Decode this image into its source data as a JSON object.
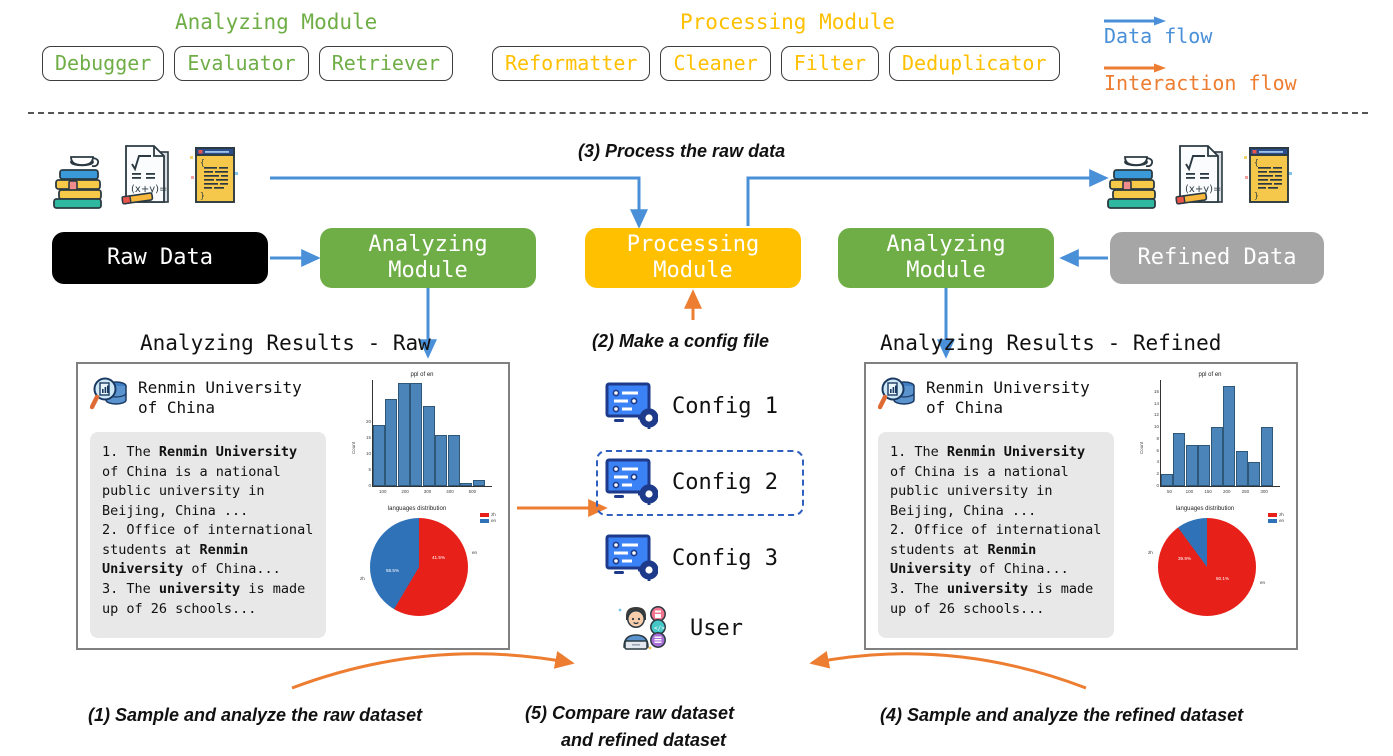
{
  "header": {
    "groups": [
      {
        "title": "Analyzing Module",
        "color": "#6fae46",
        "tags": [
          "Debugger",
          "Evaluator",
          "Retriever"
        ]
      },
      {
        "title": "Processing Module",
        "color": "#ffc000",
        "tags": [
          "Reformatter",
          "Cleaner",
          "Filter",
          "Deduplicator"
        ]
      }
    ],
    "legend": [
      {
        "label": "Data flow",
        "color": "#4a90d9",
        "icon": "arrow-right-icon"
      },
      {
        "label": "Interaction flow",
        "color": "#ed7d31",
        "icon": "arrow-right-icon"
      }
    ]
  },
  "flow": {
    "nodes": [
      {
        "name": "raw-data",
        "lines": [
          "Raw Data"
        ],
        "color": "#000000"
      },
      {
        "name": "analyzing-module-raw",
        "lines": [
          "Analyzing",
          "Module"
        ],
        "color": "#6fae46"
      },
      {
        "name": "processing-module",
        "lines": [
          "Processing",
          "Module"
        ],
        "color": "#ffc000"
      },
      {
        "name": "analyzing-module-refined",
        "lines": [
          "Analyzing",
          "Module"
        ],
        "color": "#6fae46"
      },
      {
        "name": "refined-data",
        "lines": [
          "Refined Data"
        ],
        "color": "#a6a6a6"
      }
    ],
    "step_labels": {
      "step3": "(3) Process the raw data",
      "step2": "(2) Make a config file"
    }
  },
  "captions": {
    "step1": "(1) Sample and analyze the raw dataset",
    "step5_line1": "(5) Compare raw dataset",
    "step5_line2": "and refined dataset",
    "step4": "(4) Sample and analyze the refined dataset"
  },
  "cards": [
    {
      "name": "analyzing-results-raw",
      "title": "Analyzing Results - Raw",
      "entity": "Renmin University\nof China",
      "snippet": [
        {
          "text": "1. The "
        },
        {
          "text": "Renmin University",
          "bold": true
        },
        {
          "text": "\nof China is a national\npublic university in\nBeijing, China ...\n2. Office of international\nstudents at "
        },
        {
          "text": "Renmin\nUniversity",
          "bold": true
        },
        {
          "text": " of China...\n3. The "
        },
        {
          "text": "university",
          "bold": true
        },
        {
          "text": " is made\nup of 26 schools..."
        }
      ]
    },
    {
      "name": "analyzing-results-refined",
      "title": "Analyzing Results - Refined",
      "entity": "Renmin University\nof China",
      "snippet": [
        {
          "text": "1. The "
        },
        {
          "text": "Renmin University",
          "bold": true
        },
        {
          "text": "\nof China is a national\npublic university in\nBeijing, China ...\n2. Office of international\nstudents at "
        },
        {
          "text": "Renmin\nUniversity",
          "bold": true
        },
        {
          "text": " of China...\n3. The "
        },
        {
          "text": "university",
          "bold": true
        },
        {
          "text": " is made\nup of 26 schools..."
        }
      ]
    }
  ],
  "configs": {
    "items": [
      {
        "label": "Config 1",
        "highlighted": false,
        "icon": "config-gear-icon"
      },
      {
        "label": "Config 2",
        "highlighted": true,
        "icon": "config-gear-icon"
      },
      {
        "label": "Config 3",
        "highlighted": false,
        "icon": "config-gear-icon"
      }
    ],
    "user": {
      "label": "User",
      "icon": "user-avatar-icon"
    }
  },
  "chart_data": [
    {
      "id": "raw-histogram",
      "type": "bar",
      "title": "ppl of en",
      "xlabel": "",
      "ylabel": "Count",
      "categories": [
        "100",
        "150",
        "200",
        "250",
        "300",
        "350",
        "400",
        "450",
        "500"
      ],
      "values": [
        19,
        27,
        32,
        32,
        25,
        16,
        16,
        1,
        2
      ],
      "ylim": [
        0,
        33
      ],
      "yticks": [
        0,
        5,
        10,
        15,
        20
      ],
      "xticks": [
        "100",
        "200",
        "300",
        "400",
        "500"
      ],
      "grid": false,
      "color": "#4a84b8"
    },
    {
      "id": "raw-pie",
      "type": "pie",
      "title": "languages distribution",
      "labels": [
        "zh",
        "en"
      ],
      "values": [
        58.5,
        41.5
      ],
      "value_labels": [
        "58.5%",
        "41.5%"
      ],
      "colors": [
        "#e8201a",
        "#2f72b8"
      ],
      "legend": "top-right"
    },
    {
      "id": "refined-histogram",
      "type": "bar",
      "title": "ppl of en",
      "xlabel": "",
      "ylabel": "Count",
      "categories": [
        "50",
        "100",
        "150",
        "200",
        "250",
        "300",
        "350",
        "400",
        "450"
      ],
      "values": [
        2,
        9,
        7,
        7,
        10,
        17,
        6,
        4,
        10
      ],
      "ylim": [
        0,
        18
      ],
      "yticks": [
        0,
        2,
        4,
        6,
        8,
        10,
        12,
        14,
        16
      ],
      "xticks": [
        "50",
        "100",
        "150",
        "200",
        "250",
        "300"
      ],
      "grid": false,
      "color": "#4a84b8"
    },
    {
      "id": "refined-pie",
      "type": "pie",
      "title": "languages distribution",
      "labels": [
        "zh",
        "en"
      ],
      "values": [
        39.9,
        60.1
      ],
      "value_labels": [
        "39.9%",
        "60.1%"
      ],
      "colors": [
        "#e8201a",
        "#2f72b8"
      ],
      "legend": "top-right"
    }
  ],
  "colors": {
    "data_flow": "#4a90d9",
    "interaction_flow": "#ed7d31",
    "analyzing": "#6fae46",
    "processing": "#ffc000",
    "raw": "#000000",
    "refined": "#a6a6a6"
  }
}
